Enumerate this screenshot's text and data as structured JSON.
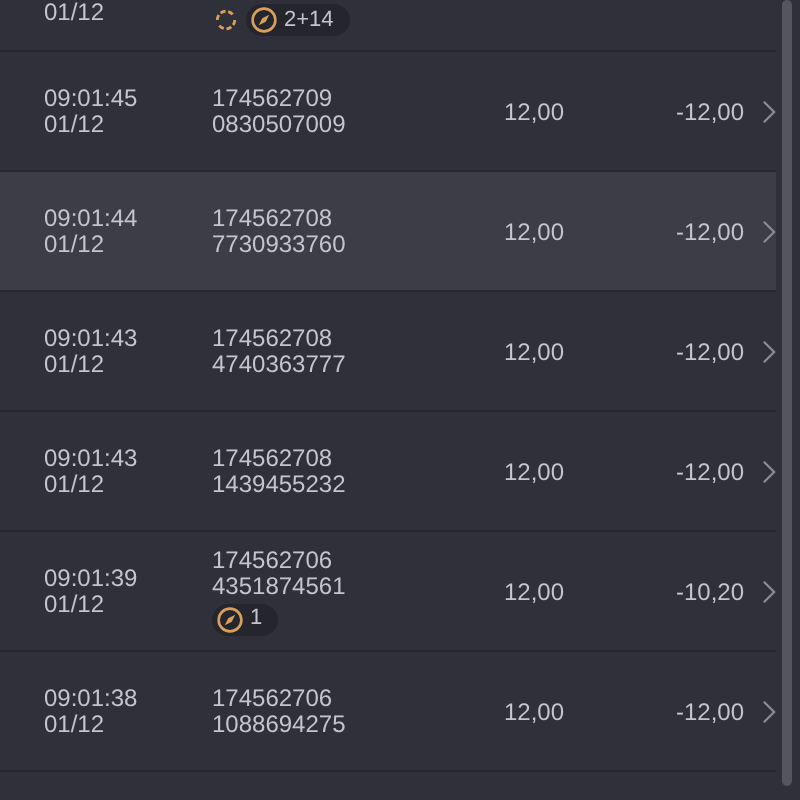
{
  "partial_row": {
    "date": "01/12",
    "badges": [
      {
        "kind": "refresh"
      },
      {
        "kind": "compass",
        "count": "2+14"
      }
    ]
  },
  "rows": [
    {
      "time": "09:01:45",
      "date": "01/12",
      "ticket": "174562709",
      "code": "0830507009",
      "amount": "12,00",
      "net": "-12,00",
      "selected": false,
      "badges": []
    },
    {
      "time": "09:01:44",
      "date": "01/12",
      "ticket": "174562708",
      "code": "7730933760",
      "amount": "12,00",
      "net": "-12,00",
      "selected": true,
      "badges": []
    },
    {
      "time": "09:01:43",
      "date": "01/12",
      "ticket": "174562708",
      "code": "4740363777",
      "amount": "12,00",
      "net": "-12,00",
      "selected": false,
      "badges": []
    },
    {
      "time": "09:01:43",
      "date": "01/12",
      "ticket": "174562708",
      "code": "1439455232",
      "amount": "12,00",
      "net": "-12,00",
      "selected": false,
      "badges": []
    },
    {
      "time": "09:01:39",
      "date": "01/12",
      "ticket": "174562706",
      "code": "4351874561",
      "amount": "12,00",
      "net": "-10,20",
      "selected": false,
      "badges": [
        {
          "kind": "compass",
          "count": "1"
        }
      ]
    },
    {
      "time": "09:01:38",
      "date": "01/12",
      "ticket": "174562706",
      "code": "1088694275",
      "amount": "12,00",
      "net": "-12,00",
      "selected": false,
      "badges": []
    }
  ]
}
